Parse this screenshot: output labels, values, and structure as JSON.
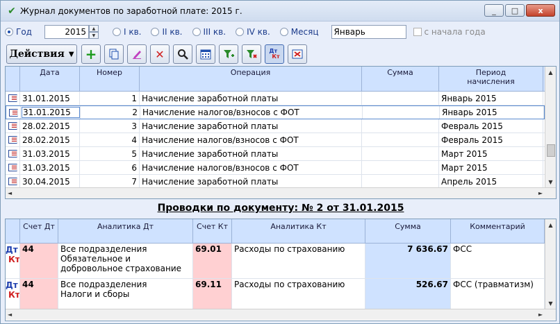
{
  "window": {
    "title": "Журнал документов по заработной плате: 2015 г.",
    "minimize": "_",
    "maximize": "□",
    "close": "x"
  },
  "period": {
    "options": [
      {
        "label": "Год",
        "selected": true
      },
      {
        "label": "I кв.",
        "selected": false
      },
      {
        "label": "II кв.",
        "selected": false
      },
      {
        "label": "III кв.",
        "selected": false
      },
      {
        "label": "IV кв.",
        "selected": false
      },
      {
        "label": "Месяц",
        "selected": false
      }
    ],
    "year": "2015",
    "month": "Январь",
    "from_start_label": "с начала года"
  },
  "toolbar": {
    "actions_label": "Действия",
    "buttons": [
      "add-icon",
      "copy-icon",
      "edit-icon",
      "delete-icon",
      "search-icon",
      "calendar-icon",
      "filter-add-icon",
      "filter-remove-icon",
      "dt-kt-icon",
      "excel-icon"
    ]
  },
  "documents": {
    "columns": [
      "Дата",
      "Номер",
      "Операция",
      "Сумма",
      "Период начисления"
    ],
    "rows": [
      {
        "date": "31.01.2015",
        "number": "1",
        "operation": "Начисление заработной платы",
        "sum": "",
        "period": "Январь 2015"
      },
      {
        "date": "31.01.2015",
        "number": "2",
        "operation": "Начисление налогов/взносов с ФОТ",
        "sum": "",
        "period": "Январь 2015"
      },
      {
        "date": "28.02.2015",
        "number": "3",
        "operation": "Начисление заработной платы",
        "sum": "",
        "period": "Февраль 2015"
      },
      {
        "date": "28.02.2015",
        "number": "4",
        "operation": "Начисление налогов/взносов с ФОТ",
        "sum": "",
        "period": "Февраль 2015"
      },
      {
        "date": "31.03.2015",
        "number": "5",
        "operation": "Начисление заработной платы",
        "sum": "",
        "period": "Март 2015"
      },
      {
        "date": "31.03.2015",
        "number": "6",
        "operation": "Начисление налогов/взносов с ФОТ",
        "sum": "",
        "period": "Март 2015"
      },
      {
        "date": "30.04.2015",
        "number": "7",
        "operation": "Начисление заработной платы",
        "sum": "",
        "period": "Апрель 2015"
      }
    ]
  },
  "postings": {
    "title": "Проводки по документу: № 2 от 31.01.2015",
    "dt_label": "Дт",
    "kt_label": "Кт",
    "columns": [
      "Счет Дт",
      "Аналитика Дт",
      "Счет Кт",
      "Аналитика Кт",
      "Сумма",
      "Комментарий"
    ],
    "rows": [
      {
        "acc_dt": "44",
        "an_dt": "Все подразделения\nОбязательное и добровольное страхование",
        "acc_kt": "69.01",
        "an_kt": "Расходы по страхованию",
        "sum": "7 636.67",
        "comment": "ФСС"
      },
      {
        "acc_dt": "44",
        "an_dt": "Все подразделения\nНалоги и сборы",
        "acc_kt": "69.11",
        "an_kt": "Расходы по страхованию",
        "sum": "526.67",
        "comment": "ФСС (травматизм)"
      }
    ]
  },
  "scroll": {
    "up": "▲",
    "down": "▼",
    "left": "◄",
    "right": "►"
  }
}
